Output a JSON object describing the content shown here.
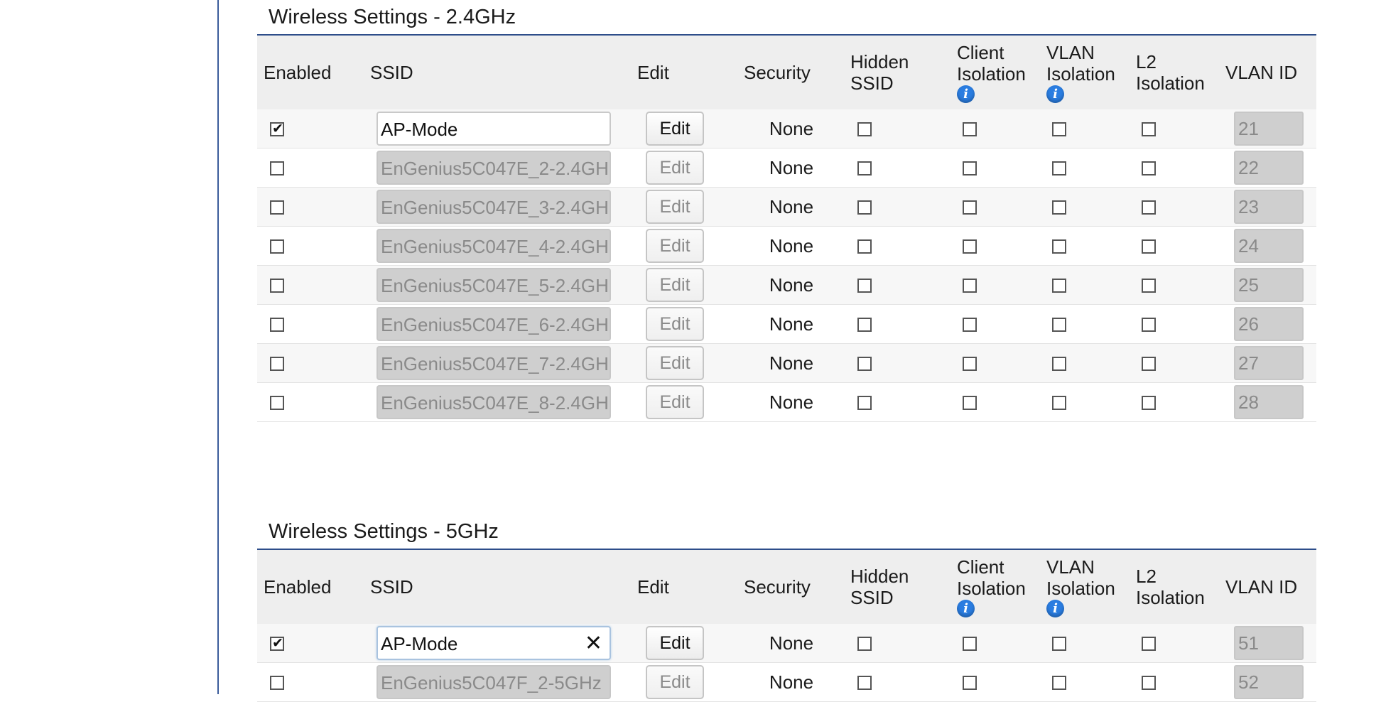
{
  "sections": [
    {
      "title": "Wireless Settings - 2.4GHz",
      "headers": {
        "enabled": "Enabled",
        "ssid": "SSID",
        "edit": "Edit",
        "security": "Security",
        "hidden_ssid": [
          "Hidden",
          "SSID"
        ],
        "client_isolation": [
          "Client",
          "Isolation"
        ],
        "vlan_isolation": [
          "VLAN",
          "Isolation"
        ],
        "l2_isolation": [
          "L2",
          "Isolation"
        ],
        "vlan_id": "VLAN ID",
        "info_glyph": "i"
      },
      "rows": [
        {
          "enabled": true,
          "ssid": "AP-Mode",
          "edit": "Edit",
          "security": "None",
          "vlan_id": "21"
        },
        {
          "enabled": false,
          "ssid": "EnGenius5C047E_2-2.4GH",
          "edit": "Edit",
          "security": "None",
          "vlan_id": "22"
        },
        {
          "enabled": false,
          "ssid": "EnGenius5C047E_3-2.4GH",
          "edit": "Edit",
          "security": "None",
          "vlan_id": "23"
        },
        {
          "enabled": false,
          "ssid": "EnGenius5C047E_4-2.4GH",
          "edit": "Edit",
          "security": "None",
          "vlan_id": "24"
        },
        {
          "enabled": false,
          "ssid": "EnGenius5C047E_5-2.4GH",
          "edit": "Edit",
          "security": "None",
          "vlan_id": "25"
        },
        {
          "enabled": false,
          "ssid": "EnGenius5C047E_6-2.4GH",
          "edit": "Edit",
          "security": "None",
          "vlan_id": "26"
        },
        {
          "enabled": false,
          "ssid": "EnGenius5C047E_7-2.4GH",
          "edit": "Edit",
          "security": "None",
          "vlan_id": "27"
        },
        {
          "enabled": false,
          "ssid": "EnGenius5C047E_8-2.4GH",
          "edit": "Edit",
          "security": "None",
          "vlan_id": "28"
        }
      ]
    },
    {
      "title": "Wireless Settings - 5GHz",
      "headers": {
        "enabled": "Enabled",
        "ssid": "SSID",
        "edit": "Edit",
        "security": "Security",
        "hidden_ssid": [
          "Hidden",
          "SSID"
        ],
        "client_isolation": [
          "Client",
          "Isolation"
        ],
        "vlan_isolation": [
          "VLAN",
          "Isolation"
        ],
        "l2_isolation": [
          "L2",
          "Isolation"
        ],
        "vlan_id": "VLAN ID",
        "info_glyph": "i"
      },
      "rows": [
        {
          "enabled": true,
          "ssid": "AP-Mode",
          "edit": "Edit",
          "security": "None",
          "vlan_id": "51",
          "focused": true,
          "clear_glyph": "✕"
        },
        {
          "enabled": false,
          "ssid": "EnGenius5C047F_2-5GHz",
          "edit": "Edit",
          "security": "None",
          "vlan_id": "52"
        }
      ]
    }
  ]
}
